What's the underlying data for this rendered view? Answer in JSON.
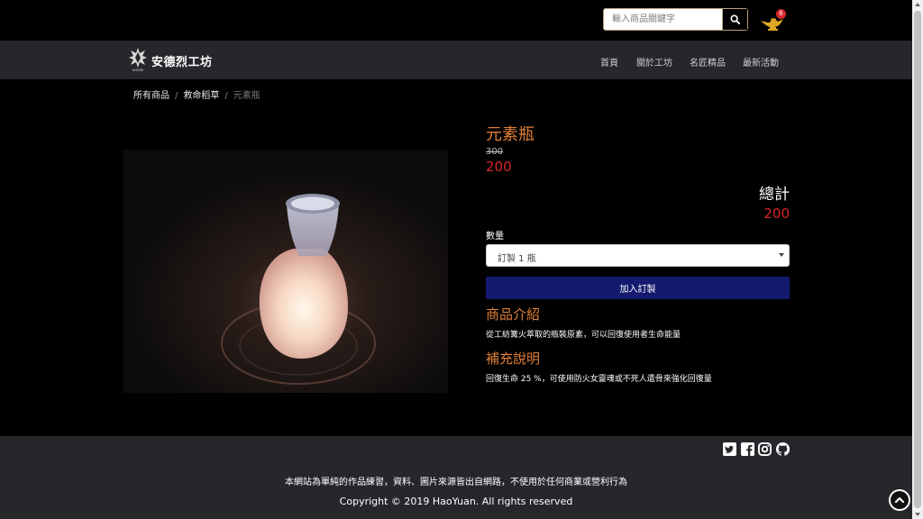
{
  "header": {
    "search": {
      "placeholder": "輸入商品關鍵字",
      "value": "",
      "icon": "search-icon"
    },
    "cart": {
      "icon": "magic-lamp-cart-icon",
      "count": "6"
    }
  },
  "navbar": {
    "brand": "安德烈工坊",
    "logo_text": "ANDRE",
    "items": [
      {
        "label": "首頁"
      },
      {
        "label": "關於工坊"
      },
      {
        "label": "名匠精品"
      },
      {
        "label": "最新活動"
      }
    ]
  },
  "breadcrumb": {
    "items": [
      {
        "label": "所有商品"
      },
      {
        "label": "救命稻草"
      },
      {
        "label": "元素瓶"
      }
    ],
    "separator": "/"
  },
  "product": {
    "name": "元素瓶",
    "old_price": "300",
    "price": "200",
    "total_label": "總計",
    "total_value": "200",
    "qty_label": "數量",
    "qty_selected": "訂製 1 瓶",
    "add_button": "加入訂製",
    "intro_title": "商品介紹",
    "intro_text": "從工紡篝火萃取的瓶裝原素，可以回復使用者生命能量",
    "notes_title": "補充說明",
    "notes_text": "回復生命 25 %，可使用防火女靈魂或不死人遺骨來強化回復量"
  },
  "footer": {
    "social_icons": [
      "twitter-icon",
      "facebook-icon",
      "instagram-icon",
      "github-icon"
    ],
    "note": "本網站為單純的作品練習，資料、圖片來源皆出自網路，不使用於任何商業或營利行為",
    "copyright": "Copyright © 2019 HaoYuan. All rights reserved"
  },
  "colors": {
    "accent_orange": "#e07f36",
    "price_red": "#d9262b",
    "button_blue": "#141a6e",
    "navbar_bg": "#25272b"
  }
}
